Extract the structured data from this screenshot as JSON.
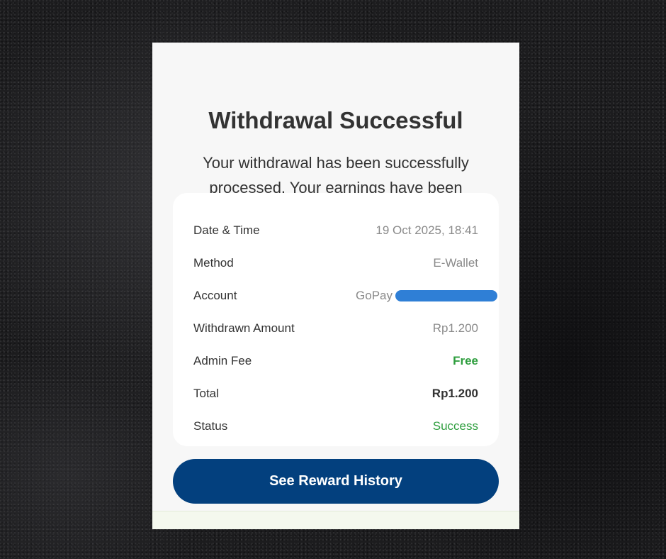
{
  "dialog": {
    "title": "Withdrawal Successful",
    "message": "Your withdrawal has been successfully processed. Your earnings have been transferred to your account."
  },
  "details": {
    "date_time": {
      "label": "Date & Time",
      "value": "19 Oct 2025, 18:41"
    },
    "method": {
      "label": "Method",
      "value": "E-Wallet"
    },
    "account": {
      "label": "Account",
      "value": "GoPay"
    },
    "withdrawn_amount": {
      "label": "Withdrawn Amount",
      "value": "Rp1.200"
    },
    "admin_fee": {
      "label": "Admin Fee",
      "value": "Free"
    },
    "total": {
      "label": "Total",
      "value": "Rp1.200"
    },
    "status": {
      "label": "Status",
      "value": "Success"
    }
  },
  "actions": {
    "primary_label": "See Reward History"
  },
  "colors": {
    "primary": "#03407e",
    "success": "#2e9e3e",
    "redaction": "#2f7fd6",
    "card_background": "#f7f7f7"
  }
}
